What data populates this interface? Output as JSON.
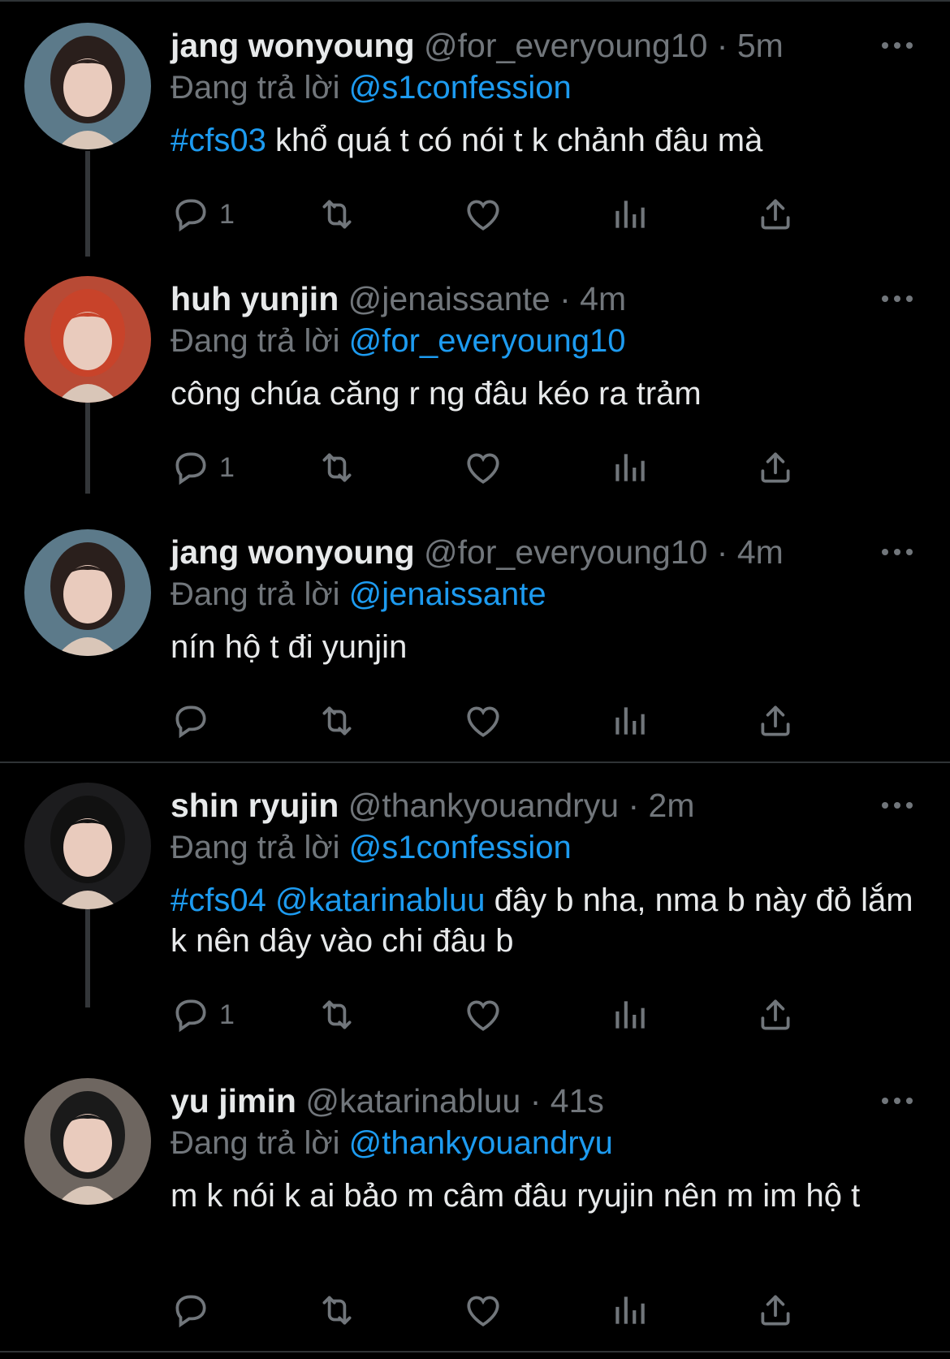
{
  "replying_label": "Đang trả lời",
  "tweets": [
    {
      "name": "jang wonyoung",
      "handle": "@for_everyoung10",
      "time": "5m",
      "reply_to": "@s1confession",
      "tag": "#cfs03",
      "mention_in_text": "",
      "text": "khổ quá t có nói t k chảnh đâu mà",
      "reply_count": "1",
      "avatar_hair": "#2a1f1c",
      "avatar_bg": "#5c7a8a"
    },
    {
      "name": "huh yunjin",
      "handle": "@jenaissante",
      "time": "4m",
      "reply_to": "@for_everyoung10",
      "tag": "",
      "mention_in_text": "",
      "text": "công chúa căng r ng đâu kéo ra trảm",
      "reply_count": "1",
      "avatar_hair": "#c8432a",
      "avatar_bg": "#b84a35"
    },
    {
      "name": "jang wonyoung",
      "handle": "@for_everyoung10",
      "time": "4m",
      "reply_to": "@jenaissante",
      "tag": "",
      "mention_in_text": "",
      "text": "nín hộ t đi yunjin",
      "reply_count": "",
      "avatar_hair": "#2a1f1c",
      "avatar_bg": "#5c7a8a"
    },
    {
      "name": "shin ryujin",
      "handle": "@thankyouandryu",
      "time": "2m",
      "reply_to": "@s1confession",
      "tag": "#cfs04",
      "mention_in_text": "@katarinabluu",
      "text": "đây b nha, nma b này đỏ lắm k nên dây vào chi đâu b",
      "reply_count": "1",
      "avatar_hair": "#111111",
      "avatar_bg": "#1c1c1e"
    },
    {
      "name": "yu jimin",
      "handle": "@katarinabluu",
      "time": "41s",
      "reply_to": "@thankyouandryu",
      "tag": "",
      "mention_in_text": "",
      "text": "m k nói k ai bảo m câm đâu ryujin nên m im hộ t",
      "reply_count": "",
      "avatar_hair": "#1a1a1a",
      "avatar_bg": "#6e6660"
    }
  ],
  "colors": {
    "background": "#000000",
    "text": "#e7e9ea",
    "muted": "#71767b",
    "accent": "#1d9bf0",
    "divider": "#2f3336"
  },
  "icons": {
    "reply": "reply-icon",
    "retweet": "retweet-icon",
    "like": "heart-icon",
    "views": "views-icon",
    "share": "share-icon",
    "more": "more-icon"
  }
}
